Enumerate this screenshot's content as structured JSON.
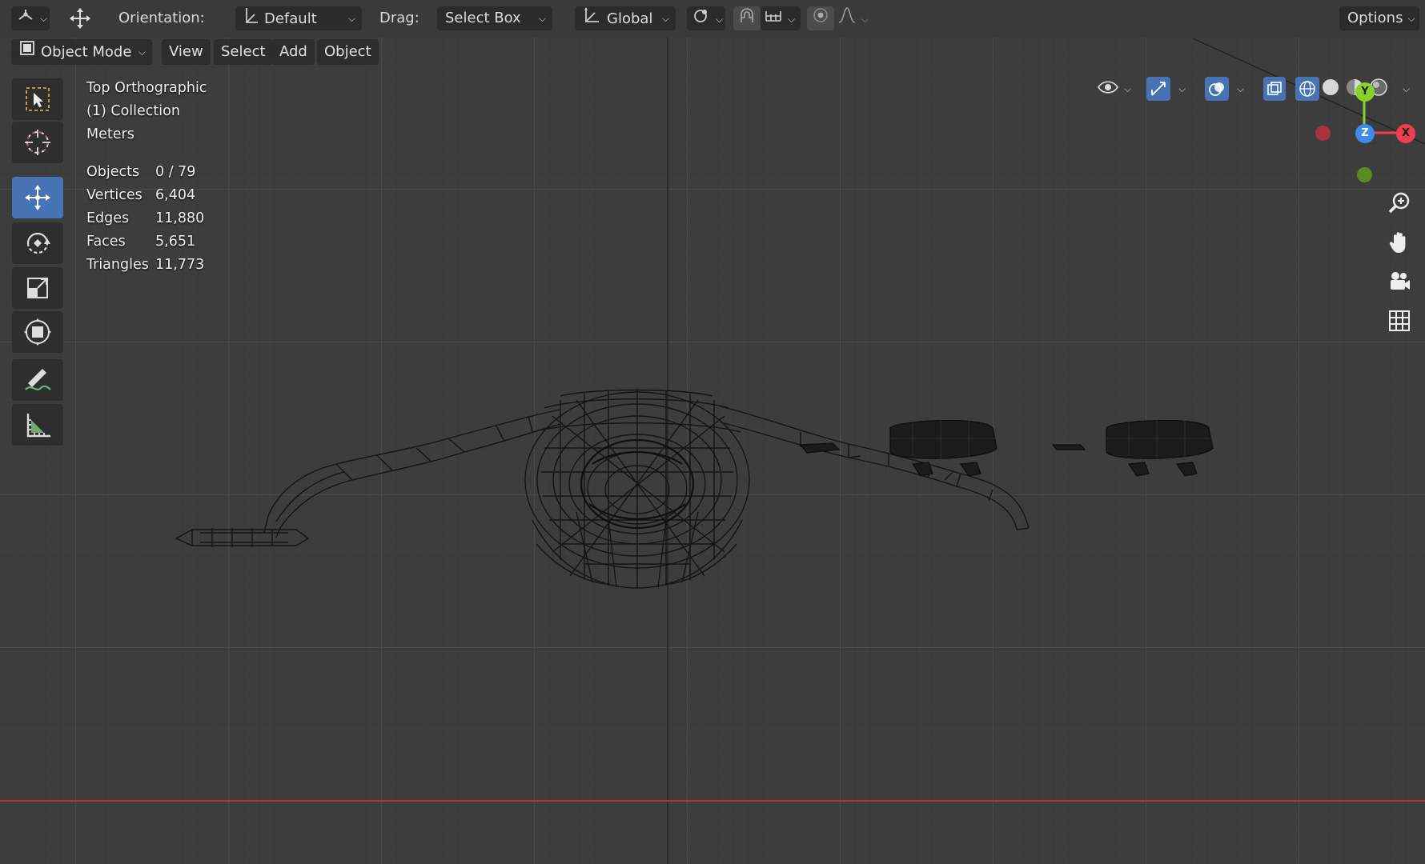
{
  "header": {
    "orientation_label": "Orientation:",
    "orientation_value": "Default",
    "drag_label": "Drag:",
    "drag_value": "Select Box",
    "transform_space": "Global",
    "options_label": "Options"
  },
  "menu": {
    "mode": "Object Mode",
    "view": "View",
    "select": "Select",
    "add": "Add",
    "object": "Object"
  },
  "overlay": {
    "view_name": "Top Orthographic",
    "collection": "(1) Collection",
    "units": "Meters",
    "stats": [
      {
        "label": "Objects",
        "value": "0 / 79"
      },
      {
        "label": "Vertices",
        "value": "6,404"
      },
      {
        "label": "Edges",
        "value": "11,880"
      },
      {
        "label": "Faces",
        "value": "5,651"
      },
      {
        "label": "Triangles",
        "value": "11,773"
      }
    ]
  },
  "gizmo": {
    "x": "X",
    "y": "Y",
    "z": "Z"
  },
  "toolbar": [
    "select-box-icon",
    "cursor-icon",
    "move-icon",
    "rotate-icon",
    "scale-icon",
    "transform-icon",
    "annotate-icon",
    "measure-icon"
  ],
  "colors": {
    "accent": "#4772b3",
    "x_axis": "#ee3e52",
    "y_axis": "#8bd12c",
    "z_axis": "#3b8cec",
    "background": "#3d3d3d"
  }
}
